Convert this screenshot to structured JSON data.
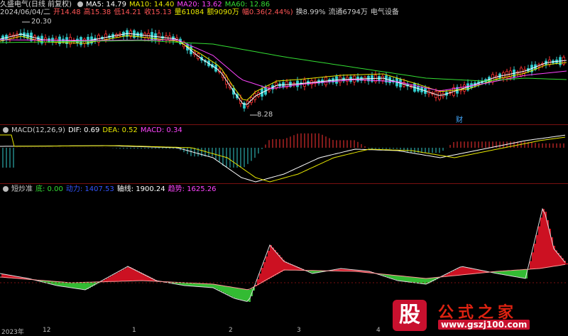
{
  "main_header": {
    "title": "久盛电气(日线 前复权)",
    "ma5": "MA5: 14.79",
    "ma10": "MA10: 14.40",
    "ma20": "MA20: 13.62",
    "ma60": "MA60: 12.86",
    "colors": {
      "ma5": "#ffffff",
      "ma10": "#e8e800",
      "ma20": "#ff44ff",
      "ma60": "#33dd33"
    }
  },
  "info_line": {
    "date": "2024/06/04/二",
    "open": "开14.48",
    "high": "高15.38",
    "low": "低14.21",
    "close": "收15.13",
    "volume": "量61084",
    "amount": "额9090万",
    "change": "幅0.36(2.44%)",
    "turnover": "换8.99%",
    "float": "流通6794万",
    "sector": "电气设备"
  },
  "price_annotations": {
    "high_mark": "20.30",
    "low_mark": "8.28",
    "event_badge": "财"
  },
  "macd_header": {
    "title": "MACD(12,26,9)",
    "dif": "DIF: 0.69",
    "dea": "DEA: 0.52",
    "macd": "MACD: 0.34",
    "colors": {
      "dif": "#ffffff",
      "dea": "#e8e800",
      "macd": "#ff44ff"
    }
  },
  "indicator_header": {
    "title": "短炒准",
    "bottom": "底: 0.00",
    "momentum": "动力: 1407.53",
    "axis": "轴线: 1900.24",
    "trend": "趋势: 1625.26",
    "colors": {
      "bottom": "#33dd33",
      "momentum": "#3355ff",
      "axis": "#ffffff",
      "trend": "#ff44ff"
    }
  },
  "date_axis": {
    "labels": [
      "2023年",
      "12",
      "1",
      "2",
      "3",
      "4"
    ]
  },
  "watermark": {
    "logo_char": "股",
    "name": "公式之家",
    "url": "www.gszj100.com"
  },
  "chart_colors": {
    "up": "#ff3333",
    "down": "#33cccc",
    "divider": "#7a1010"
  }
}
